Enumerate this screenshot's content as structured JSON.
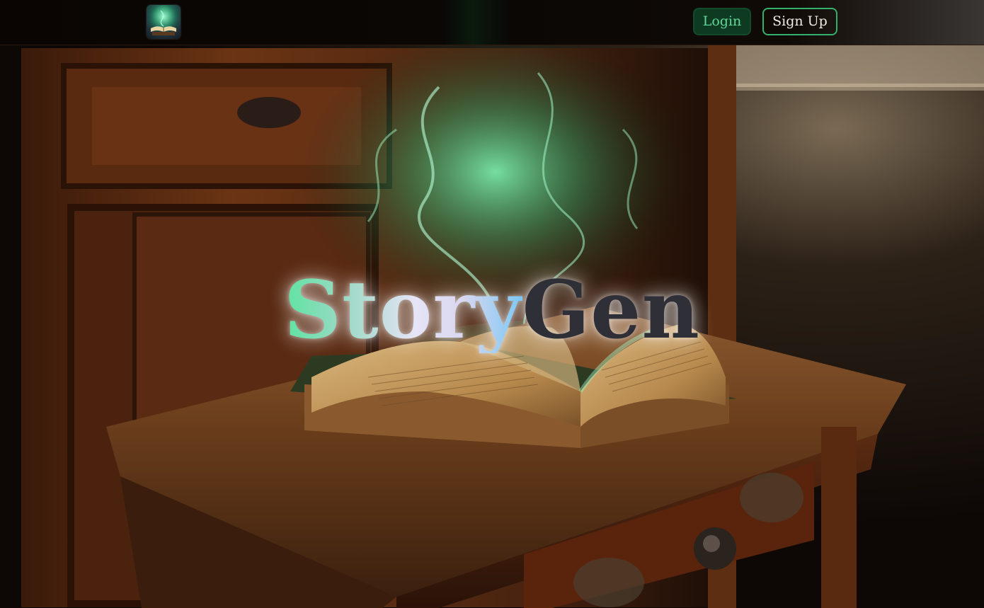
{
  "navbar": {
    "logo_icon": "open-book-logo-icon",
    "login_label": "Login",
    "signup_label": "Sign Up"
  },
  "hero": {
    "title_part1": "Story",
    "title_part2": "Gen",
    "scene_description_icon": "open-book-on-wooden-table-illustration"
  },
  "colors": {
    "accent_green": "#2f9b62",
    "login_text": "#5fd89a",
    "signup_text": "#f1ece4",
    "title_gradient_start": "#5ee3a1",
    "title_gradient_mid": "#e6e4f7",
    "title_gradient_end": "#7cc8f5",
    "title_gen": "#2f2f38"
  }
}
